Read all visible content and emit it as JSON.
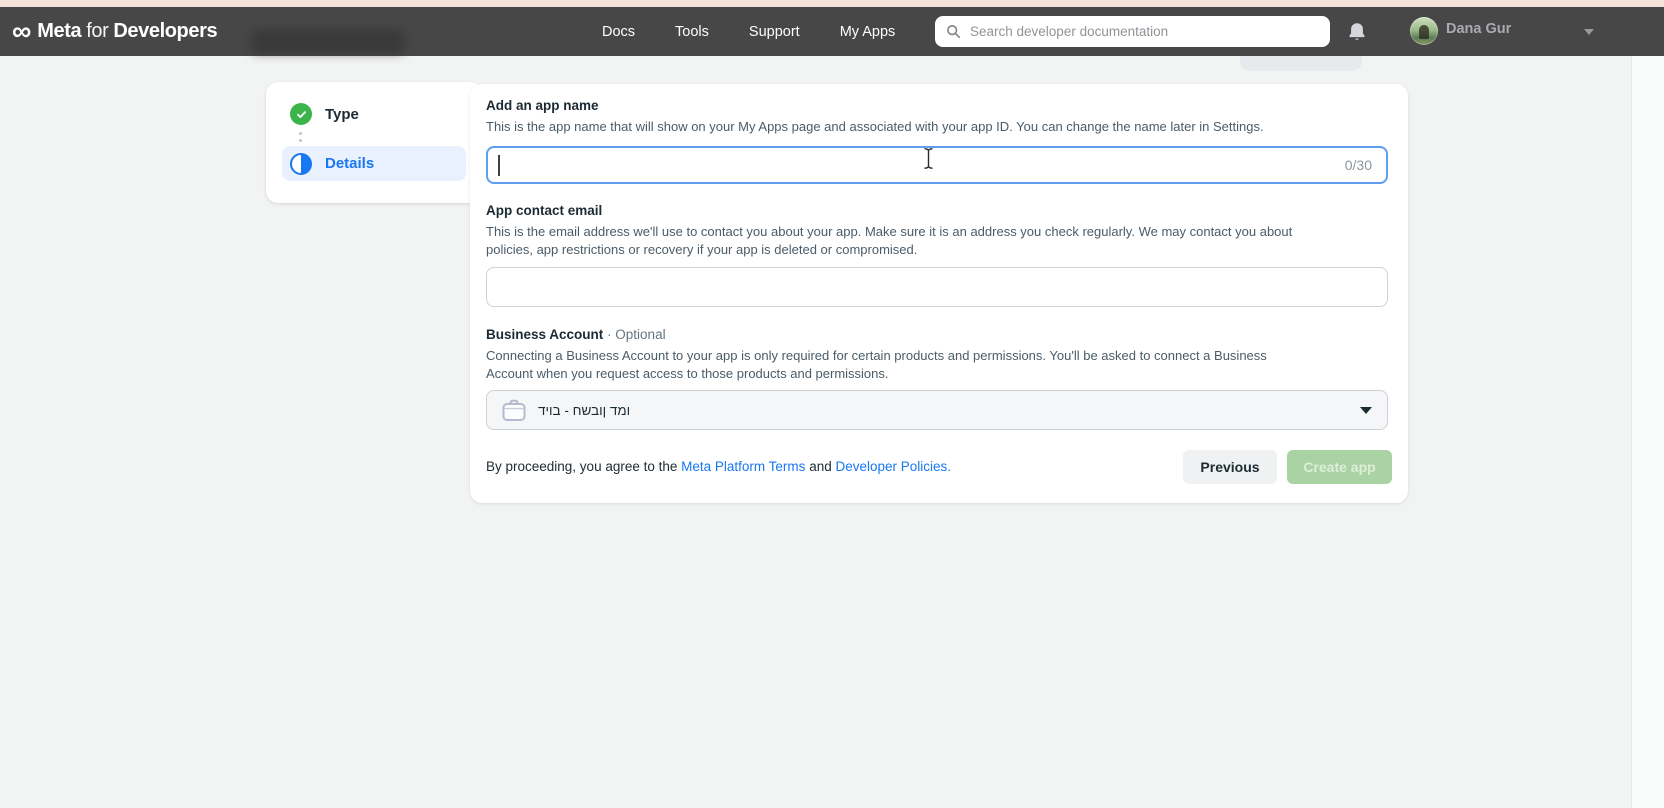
{
  "header": {
    "logo": {
      "infinity_symbol": "∞",
      "meta": "Meta",
      "for": "for",
      "developers": "Developers"
    },
    "nav": [
      {
        "label": "Docs"
      },
      {
        "label": "Tools"
      },
      {
        "label": "Support"
      },
      {
        "label": "My Apps"
      }
    ],
    "search_placeholder": "Search developer documentation",
    "user_name": "Dana Gur"
  },
  "stepper": {
    "steps": [
      {
        "label": "Type",
        "state": "complete"
      },
      {
        "label": "Details",
        "state": "current"
      }
    ]
  },
  "form": {
    "app_name": {
      "title": "Add an app name",
      "description": "This is the app name that will show on your My Apps page and associated with your app ID. You can change the name later in Settings.",
      "value": "",
      "counter": "0/30",
      "max_length": 30
    },
    "contact_email": {
      "title": "App contact email",
      "description": "This is the email address we'll use to contact you about your app. Make sure it is an address you check regularly. We may contact you about\npolicies, app restrictions or recovery if your app is deleted or compromised.",
      "value": ""
    },
    "business_account": {
      "title": "Business Account",
      "optional_suffix": "· Optional",
      "description": "Connecting a Business Account to your app is only required for certain products and permissions. You'll be asked to connect a Business\nAccount when you request access to those products and permissions.",
      "selected_value": "דיוב - חשבון דמו"
    },
    "footer": {
      "agree_prefix": "By proceeding, you agree to the ",
      "terms_link": "Meta Platform Terms",
      "and_text": " and ",
      "policies_link": "Developer Policies.",
      "previous_label": "Previous",
      "create_label": "Create app",
      "create_enabled": false
    }
  },
  "icons": {
    "search": "magnifier",
    "notifications": "bell",
    "profile_menu": "chevron-down",
    "step_complete": "check-circle",
    "step_current": "half-filled-circle",
    "business_account": "briefcase",
    "select_open": "caret-down",
    "mouse_cursor": "i-beam"
  },
  "colors": {
    "accent_blue": "#1877f2",
    "success_green": "#3bb54a",
    "disabled_green": "#a9d3a2",
    "header_bg": "#474747",
    "top_strip": "#f4e1d9",
    "page_bg": "#f2f3f3",
    "focus_border": "#5f9df2"
  }
}
